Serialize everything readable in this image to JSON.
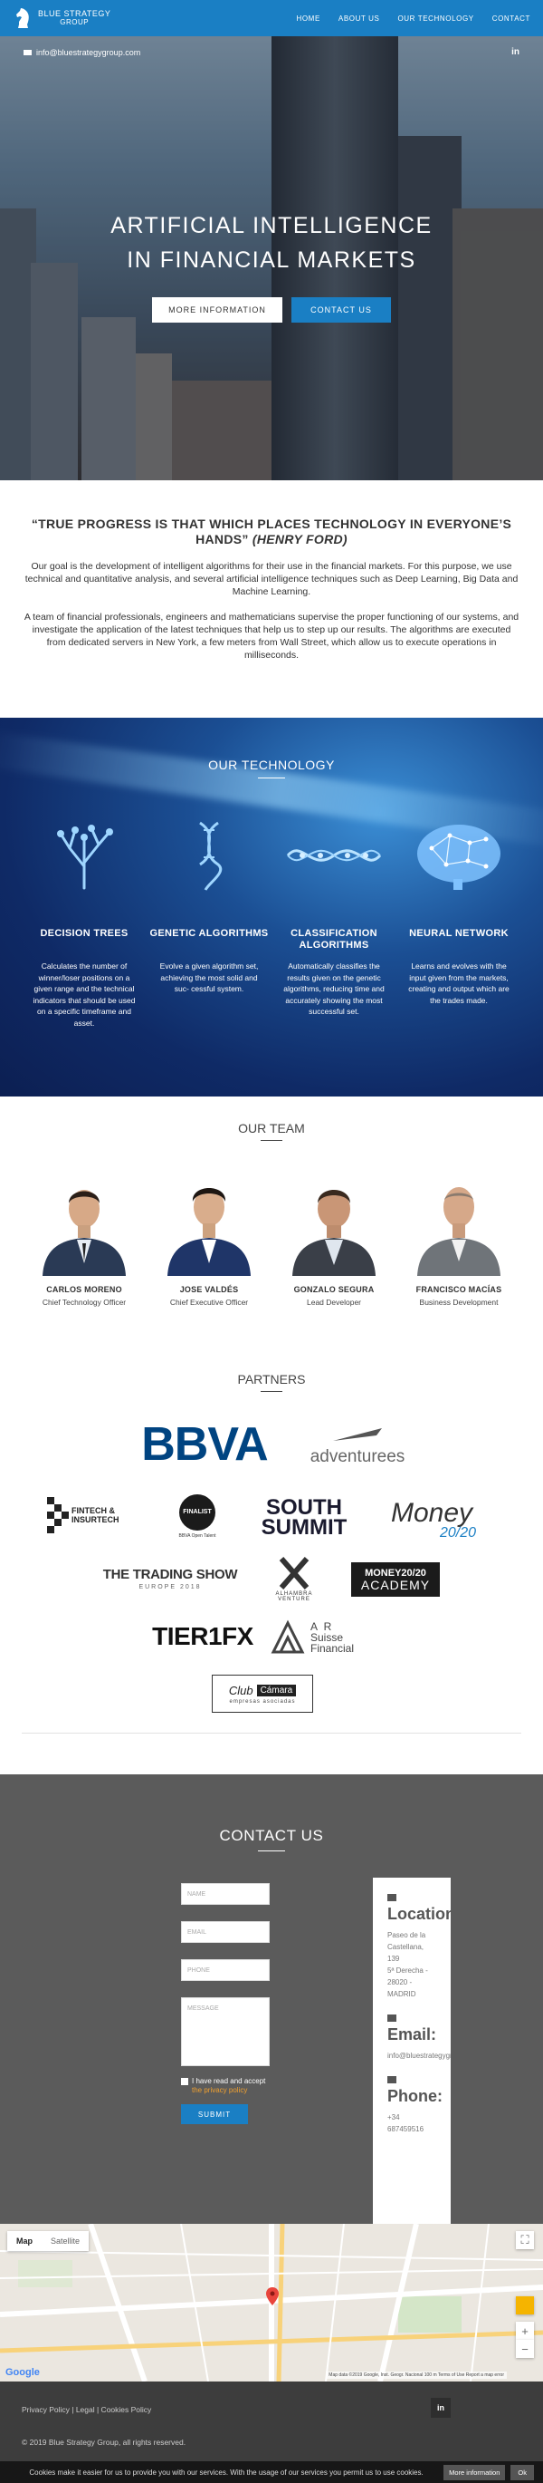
{
  "nav": {
    "logo_name": "BLUE STRATEGY",
    "logo_sub": "GROUP",
    "links": [
      "HOME",
      "ABOUT US",
      "OUR TECHNOLOGY",
      "CONTACT"
    ]
  },
  "hero": {
    "email": "info@bluestrategygroup.com",
    "social": "in",
    "title_line1": "ARTIFICIAL INTELLIGENCE",
    "title_line2": "IN FINANCIAL MARKETS",
    "btn_more": "MORE INFORMATION",
    "btn_contact": "CONTACT US"
  },
  "quote": {
    "text": "“TRUE PROGRESS IS THAT WHICH PLACES TECHNOLOGY IN EVERYONE’S HANDS”",
    "author": "(HENRY FORD)",
    "para1": "Our goal is the development of intelligent algorithms for their use in the financial markets. For this purpose, we use technical and quantitative analysis, and several artificial intelligence techniques such as Deep Learning, Big Data and Machine Learning.",
    "para2": "A team of financial professionals, engineers and mathematicians supervise the proper functioning of our systems, and investigate the application of the latest techniques that help us to step up our results. The algorithms are executed from dedicated servers in New York, a few meters from Wall Street, which allow us to execute operations in milliseconds."
  },
  "technology": {
    "title": "OUR TECHNOLOGY",
    "items": [
      {
        "title": "DECISION TREES",
        "text": "Calculates the number of winner/loser positions on a given range and the technical indicators that should be used on a specific timeframe and asset.",
        "icon": "tree-icon"
      },
      {
        "title": "GENETIC ALGORITHMS",
        "text": "Evolve a given algorithm set, achieving the most solid and suc- cessful system.",
        "icon": "dna-icon"
      },
      {
        "title": "CLASSIFICATION ALGORITHMS",
        "text": "Automatically classifies the results given on the genetic algorithms, reducing time and accurately showing the most successful set.",
        "icon": "molecule-icon"
      },
      {
        "title": "NEURAL NETWORK",
        "text": "Learns and evolves with the input given from the markets, creating and output which are the trades made.",
        "icon": "brain-icon"
      }
    ]
  },
  "team": {
    "title": "OUR TEAM",
    "members": [
      {
        "name": "CARLOS MORENO",
        "role": "Chief Technology Officer"
      },
      {
        "name": "JOSE VALDÉS",
        "role": "Chief Executive Officer"
      },
      {
        "name": "GONZALO SEGURA",
        "role": "Lead Developer"
      },
      {
        "name": "FRANCISCO MACÍAS",
        "role": "Business Development"
      }
    ]
  },
  "partners": {
    "title": "PARTNERS",
    "logos": {
      "bbva": "BBVA",
      "adventurees": "adventurees",
      "fintech": "FINTECH & INSURTECH",
      "finalist": "FINALIST",
      "finalist_sub": "BBVA Open Talent",
      "south": "SOUTH",
      "summit": "SUMMIT",
      "money": "Money",
      "money_num": "20/20",
      "trading": "THE TRADING SHOW",
      "trading_sub": "EUROPE 2018",
      "alhambra": "ALHAMBRA VENTURE",
      "academy1": "MONEY20/20",
      "academy2": "ACADEMY",
      "tier1": "TIER1FX",
      "ar1": "A R",
      "ar2": "Suisse",
      "ar3": "Financial",
      "club1": "Club",
      "club2": "Cámara",
      "club3": "empresas asociadas"
    }
  },
  "contact": {
    "title": "CONTACT US",
    "placeholders": {
      "name": "NAME",
      "email": "EMAIL",
      "phone": "PHONE",
      "message": "MESSAGE"
    },
    "accept_text": "I have read and accept",
    "accept_link": "the privacy policy",
    "submit": "SUBMIT",
    "location_label": "Location:",
    "location_lines": [
      "Paseo de la",
      "Castellana,",
      "139",
      "5ª Derecha -",
      "28020 -",
      "MADRID"
    ],
    "email_label": "Email:",
    "email_value": "info@bluestrategygroup.com",
    "phone_label": "Phone:",
    "phone_lines": [
      "+34",
      "687459516"
    ]
  },
  "map": {
    "tab_map": "Map",
    "tab_satellite": "Satellite",
    "credit": "Map data ©2019 Google, Inst. Geogr. Nacional  100 m  Terms of Use  Report a map error",
    "google": "Google"
  },
  "footer": {
    "links": "Privacy Policy | Legal | Cookies Policy",
    "social": "in",
    "copyright": "© 2019 Blue Strategy Group, all rights reserved."
  },
  "cookie": {
    "text": "Cookies make it easier for us to provide you with our services. With the usage of our services you permit us to use cookies.",
    "more": "More information",
    "ok": "Ok"
  }
}
